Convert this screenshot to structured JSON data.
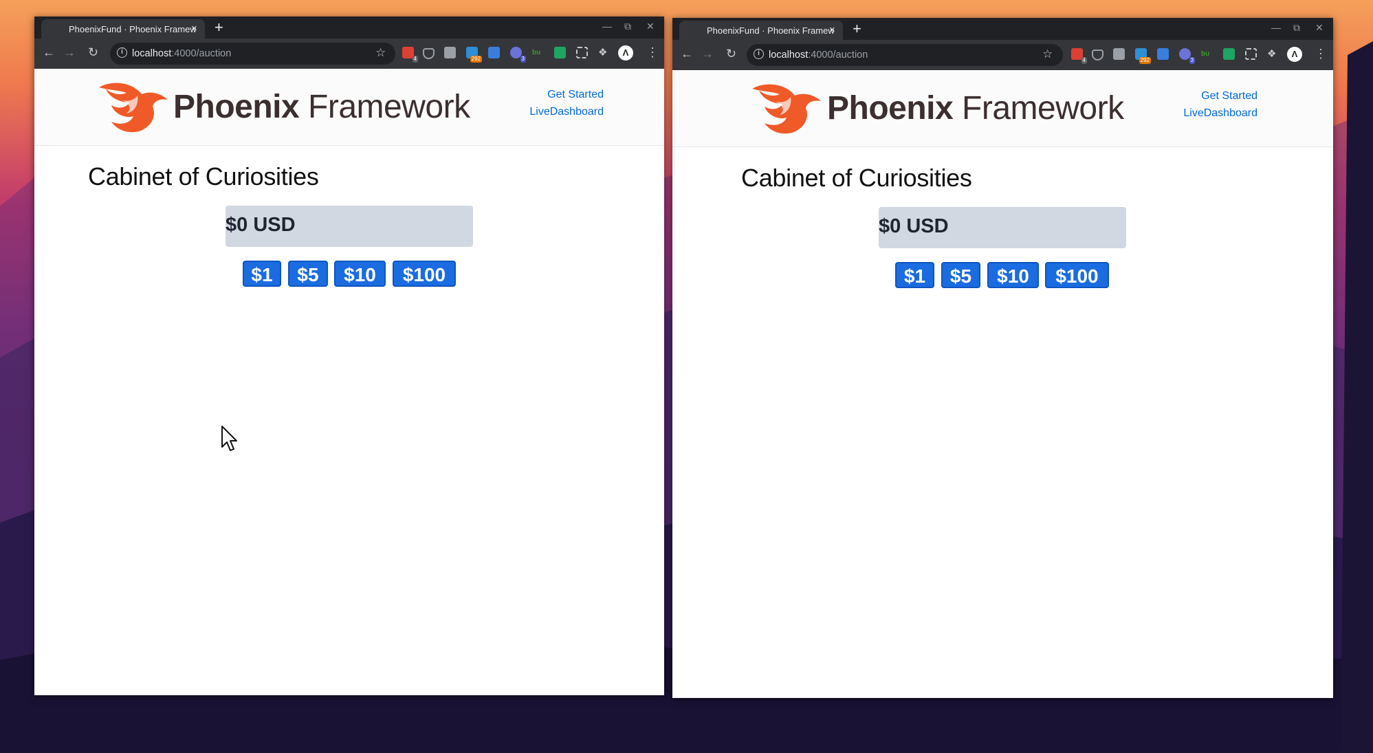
{
  "windows": [
    {
      "tab_title": "PhoenixFund · Phoenix Framework",
      "tab_close": "×",
      "new_tab": "+",
      "url_host": "localhost",
      "url_path": ":4000/auction",
      "ext_badges": [
        "4",
        "292",
        "3"
      ],
      "logo_bold": "Phoenix",
      "logo_light": " Framework",
      "nav": [
        "Get Started",
        "LiveDashboard"
      ],
      "title": "Cabinet of Curiosities",
      "amount": "$0 USD",
      "bids": [
        "$1",
        "$5",
        "$10",
        "$100"
      ]
    },
    {
      "tab_title": "PhoenixFund · Phoenix Framework",
      "tab_close": "×",
      "new_tab": "+",
      "url_host": "localhost",
      "url_path": ":4000/auction",
      "ext_badges": [
        "4",
        "292",
        "3"
      ],
      "logo_bold": "Phoenix",
      "logo_light": " Framework",
      "nav": [
        "Get Started",
        "LiveDashboard"
      ],
      "title": "Cabinet of Curiosities",
      "amount": "$0 USD",
      "bids": [
        "$1",
        "$5",
        "$10",
        "$100"
      ]
    }
  ],
  "colors": {
    "brand_orange": "#f05a28",
    "link_blue": "#0069d9",
    "bid_button_blue": "#1a6ce0",
    "amount_box_gray": "#d1d8e2",
    "chrome_dark": "#202124"
  }
}
